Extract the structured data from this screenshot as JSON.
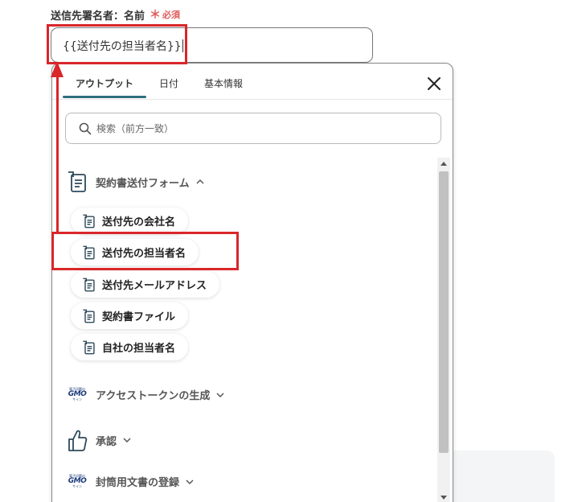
{
  "field": {
    "label": "送信先署名者：名前",
    "required_mark": "＊",
    "required_text": "必須",
    "value": "{{送付先の担当者名}}"
  },
  "picker": {
    "tabs": [
      {
        "label": "アウトプット",
        "active": true
      },
      {
        "label": "日付",
        "active": false
      },
      {
        "label": "基本情報",
        "active": false
      }
    ],
    "search_placeholder": "検索（前方一致）",
    "sections": [
      {
        "label": "契約書送付フォーム",
        "icon": "form-icon",
        "expanded": true,
        "items": [
          {
            "label": "送付先の会社名",
            "icon": "form-icon"
          },
          {
            "label": "送付先の担当者名",
            "icon": "form-icon",
            "highlighted": true
          },
          {
            "label": "送付先メールアドレス",
            "icon": "form-icon"
          },
          {
            "label": "契約書ファイル",
            "icon": "form-icon"
          },
          {
            "label": "自社の担当者名",
            "icon": "form-icon"
          }
        ]
      },
      {
        "label": "アクセストークンの生成",
        "icon": "gmo-sign-logo",
        "expanded": false
      },
      {
        "label": "承認",
        "icon": "thumbs-up-icon",
        "expanded": false
      },
      {
        "label": "封筒用文書の登録",
        "icon": "gmo-sign-logo",
        "expanded": false
      }
    ]
  },
  "gmo_logo": {
    "top": "電子印鑑の",
    "main": "GMO",
    "bottom": "サイン"
  },
  "colors": {
    "accent": "#2e6e7e",
    "annotation": "#d9262a",
    "required": "#e05a5a"
  }
}
